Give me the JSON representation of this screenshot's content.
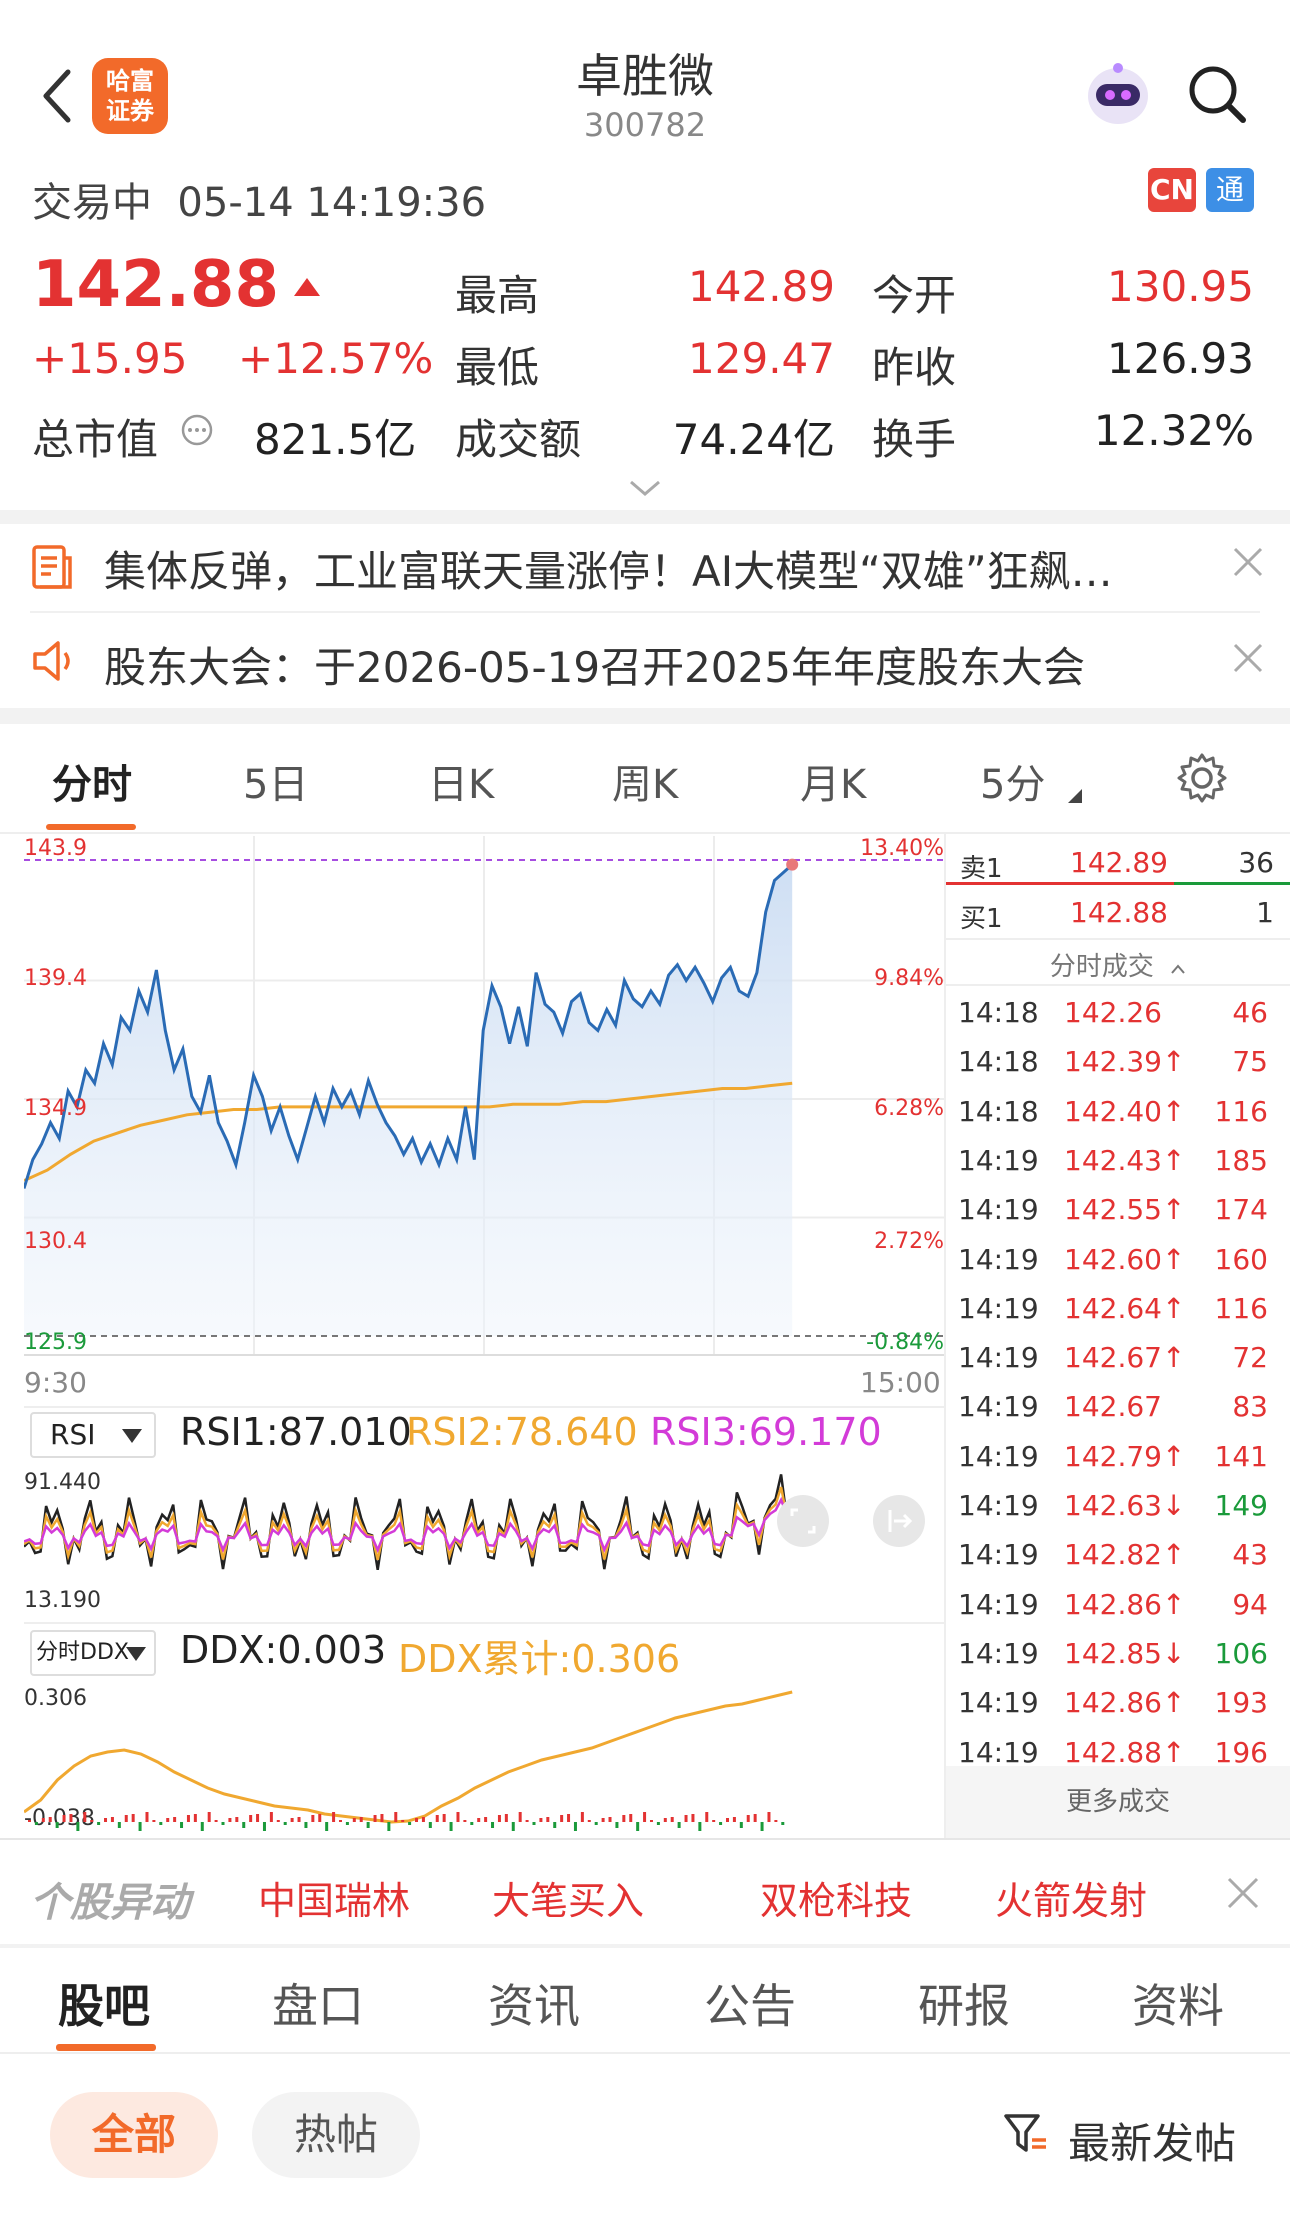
{
  "header": {
    "title": "卓胜微",
    "code": "300782",
    "broker_logo": "哈富证券",
    "back_icon": "chevron-left-icon",
    "assistant_icon": "robot-avatar-icon",
    "search_icon": "search-icon"
  },
  "status": {
    "text": "交易中  05-14 14:19:36",
    "cn_badge": "CN",
    "tong_badge": "通"
  },
  "quote": {
    "price": "142.88",
    "change": "+15.95",
    "change_pct": "+12.57%",
    "high_label": "最高",
    "high": "142.89",
    "low_label": "最低",
    "low": "129.47",
    "open_label": "今开",
    "open": "130.95",
    "prev_label": "昨收",
    "prev": "126.93",
    "mcap_label": "总市值",
    "mcap": "821.5亿",
    "amount_label": "成交额",
    "amount": "74.24亿",
    "turnover_label": "换手",
    "turnover": "12.32%"
  },
  "notices": [
    {
      "icon": "news-doc-icon",
      "text": "集体反弹，工业富联天量涨停！AI大模型“双雄”狂飙…"
    },
    {
      "icon": "speaker-icon",
      "text": "股东大会：于2026-05-19召开2025年年度股东大会"
    }
  ],
  "chart_tabs": [
    "分时",
    "5日",
    "日K",
    "周K",
    "月K",
    "5分"
  ],
  "chart_data": {
    "type": "line",
    "y_left_ticks": [
      "143.9",
      "139.4",
      "134.9",
      "130.4",
      "125.9"
    ],
    "y_right_ticks": [
      "13.40%",
      "9.84%",
      "6.28%",
      "2.72%",
      "-0.84%"
    ],
    "x_ticks": [
      "9:30",
      "15:00"
    ],
    "ylim": [
      125.9,
      143.9
    ],
    "series": [
      {
        "values": [
          131.5,
          132.6,
          133.2,
          134.0,
          133.4,
          135.2,
          134.6,
          136.0,
          135.5,
          137.0,
          136.2,
          138.0,
          137.5,
          139.0,
          138.2,
          139.8,
          137.5,
          136.0,
          136.8,
          135.0,
          134.4,
          135.8,
          134.0,
          133.3,
          132.4,
          134.0,
          135.8,
          135.0,
          133.7,
          134.6,
          133.5,
          132.6,
          133.8,
          135.0,
          134.0,
          135.3,
          134.6,
          135.2,
          134.3,
          135.6,
          134.7,
          134.0,
          133.5,
          132.8,
          133.4,
          132.5,
          133.2,
          132.4,
          133.4,
          132.6,
          134.6,
          132.6,
          137.5,
          139.2,
          138.4,
          137.0,
          138.4,
          136.9,
          139.7,
          138.5,
          138.2,
          137.4,
          138.6,
          138.9,
          137.8,
          137.5,
          138.3,
          137.7,
          139.4,
          138.7,
          138.4,
          139.0,
          138.5,
          139.6,
          140.0,
          139.4,
          139.9,
          139.3,
          138.6,
          139.5,
          139.9,
          139.0,
          138.8,
          139.7,
          142.0,
          143.2,
          143.5,
          143.8
        ]
      },
      {
        "values": [
          131.8,
          132.2,
          132.8,
          133.3,
          133.6,
          133.9,
          134.1,
          134.3,
          134.4,
          134.5,
          134.5,
          134.6,
          134.6,
          134.6,
          134.6,
          134.6,
          134.6,
          134.6,
          134.6,
          134.6,
          134.6,
          134.7,
          134.7,
          134.7,
          134.8,
          134.8,
          134.9,
          135.0,
          135.1,
          135.2,
          135.3,
          135.3,
          135.4,
          135.5
        ]
      }
    ]
  },
  "indicators": {
    "rsi_selector": "RSI",
    "rsi1": "RSI1:87.010",
    "rsi2": "RSI2:78.640",
    "rsi3": "RSI3:69.170",
    "rsi_max": "91.440",
    "rsi_min": "13.190",
    "ddx_selector": "分时DDX",
    "ddx": "DDX:0.003",
    "ddx_cum": "DDX累计:0.306",
    "ddx_max": "0.306",
    "ddx_min": "-0.038"
  },
  "orderbook": {
    "sell_label": "卖1",
    "sell_price": "142.89",
    "sell_vol": "36",
    "buy_label": "买1",
    "buy_price": "142.88",
    "buy_vol": "1",
    "trades_title": "分时成交",
    "more": "更多成交",
    "trades": [
      {
        "t": "14:18",
        "p": "142.26",
        "v": "46",
        "vc": "red"
      },
      {
        "t": "14:18",
        "p": "142.39↑",
        "v": "75",
        "vc": "red"
      },
      {
        "t": "14:18",
        "p": "142.40↑",
        "v": "116",
        "vc": "red"
      },
      {
        "t": "14:19",
        "p": "142.43↑",
        "v": "185",
        "vc": "red"
      },
      {
        "t": "14:19",
        "p": "142.55↑",
        "v": "174",
        "vc": "red"
      },
      {
        "t": "14:19",
        "p": "142.60↑",
        "v": "160",
        "vc": "red"
      },
      {
        "t": "14:19",
        "p": "142.64↑",
        "v": "116",
        "vc": "red"
      },
      {
        "t": "14:19",
        "p": "142.67↑",
        "v": "72",
        "vc": "red"
      },
      {
        "t": "14:19",
        "p": "142.67",
        "v": "83",
        "vc": "red"
      },
      {
        "t": "14:19",
        "p": "142.79↑",
        "v": "141",
        "vc": "red"
      },
      {
        "t": "14:19",
        "p": "142.63↓",
        "v": "149",
        "vc": "green"
      },
      {
        "t": "14:19",
        "p": "142.82↑",
        "v": "43",
        "vc": "red"
      },
      {
        "t": "14:19",
        "p": "142.86↑",
        "v": "94",
        "vc": "red"
      },
      {
        "t": "14:19",
        "p": "142.85↓",
        "v": "106",
        "vc": "green"
      },
      {
        "t": "14:19",
        "p": "142.86↑",
        "v": "193",
        "vc": "red"
      },
      {
        "t": "14:19",
        "p": "142.88↑",
        "v": "196",
        "vc": "red"
      }
    ]
  },
  "movers": {
    "title": "个股异动",
    "items": [
      "中国瑞林",
      "大笔买入",
      "双枪科技",
      "火箭发射"
    ]
  },
  "bottom_tabs": [
    "股吧",
    "盘口",
    "资讯",
    "公告",
    "研报",
    "资料"
  ],
  "filters": {
    "all": "全部",
    "hot": "热帖",
    "newest": "最新发帖"
  },
  "colors": {
    "up": "#e33232",
    "down": "#1a9a3a",
    "price_line": "#2a6bb5",
    "avg_line": "#f0a830",
    "accent": "#f26a2a"
  }
}
